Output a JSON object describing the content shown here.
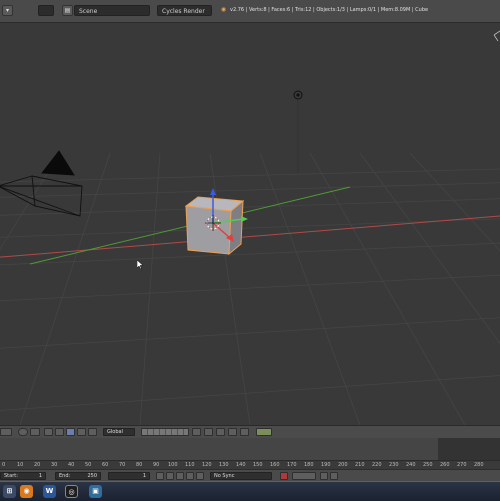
{
  "header": {
    "menu_field": "",
    "scene_name": "Scene",
    "render_engine": "Cycles Render",
    "stats": "v2.76 | Verts:8 | Faces:6 | Tris:12 | Objects:1/3 | Lamps:0/1 | Mem:8.09M | Cube"
  },
  "viewport_toolbar": {
    "orientation": "Global"
  },
  "timeline": {
    "frame_numbers": [
      "0",
      "10",
      "20",
      "30",
      "40",
      "50",
      "60",
      "70",
      "80",
      "90",
      "100",
      "110",
      "120",
      "130",
      "140",
      "150",
      "160",
      "170",
      "180",
      "190",
      "200",
      "210",
      "220",
      "230",
      "240",
      "250",
      "260",
      "270",
      "280"
    ],
    "start_label": "Start:",
    "start_value": "1",
    "end_label": "End:",
    "end_value": "250",
    "current_frame": "1",
    "sync_mode": "No Sync"
  },
  "colors": {
    "x_axis": "#b04a4a",
    "y_axis": "#5fa83a",
    "selection_outline": "#f0a050",
    "cube_face": "#9c9c9c",
    "taskbar": "#1b2230"
  }
}
